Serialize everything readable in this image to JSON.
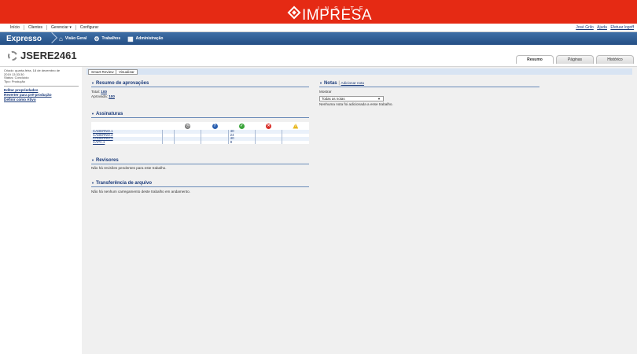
{
  "brand": {
    "name": "IMPRESA",
    "tagline": "INSITE"
  },
  "topmenu": {
    "items": [
      "Início",
      "Clientes",
      "Gerenciar ▾",
      "Configurar"
    ],
    "user_links": [
      "José Grilo",
      "Ajuda",
      "Efetuar logoff"
    ]
  },
  "appbar": {
    "app_name": "Expresso",
    "nav": [
      "Visão Geral",
      "Trabalhos",
      "Administração"
    ]
  },
  "job": {
    "title": "JSERE2461",
    "tabs": [
      "Resumo",
      "Páginas",
      "Histórico"
    ],
    "active_tab": "Resumo"
  },
  "sidebar": {
    "info": [
      "Criado: quarta-feira, 18 de dezembro de",
      "2019 13:33:30",
      "Status: Concluído",
      "Tipo: Produção"
    ],
    "links": [
      "Editar propriedades",
      "Reverter para pré-produção",
      "Definir como Ativo"
    ]
  },
  "toolbar": {
    "smart_review": "Smart Review",
    "visualizar": "Visualizar"
  },
  "approvals": {
    "heading": "Resumo de aprovações",
    "total_label": "Total:",
    "total_value": "100",
    "approved_label": "Aprovada:",
    "approved_value": "100"
  },
  "signatures": {
    "heading": "Assinaturas",
    "rows": [
      {
        "name": "CADERNO.1",
        "approved": "40"
      },
      {
        "name": "CADERNO.2",
        "approved": "24"
      },
      {
        "name": "CADERNO.3",
        "approved": "40"
      },
      {
        "name": "CAPA.1",
        "approved": "8"
      }
    ],
    "icon_colors": {
      "clock": "#777777",
      "question": "#2a5fb0",
      "approved": "#3aa43a",
      "rejected": "#d9302a",
      "warning": "#e8b820"
    }
  },
  "reviewers": {
    "heading": "Revisores",
    "text": "Não há revisões pendentes para este trabalho."
  },
  "transfer": {
    "heading": "Transferência de arquivo",
    "text": "Não há nenhum carregamento deste trabalho em andamento."
  },
  "notes": {
    "heading": "Notas",
    "add_link": "Adicionar nota",
    "show_label": "Mostrar",
    "select_value": "Todas as notas",
    "empty_text": "Nenhuma nota foi adicionada a esse trabalho."
  }
}
